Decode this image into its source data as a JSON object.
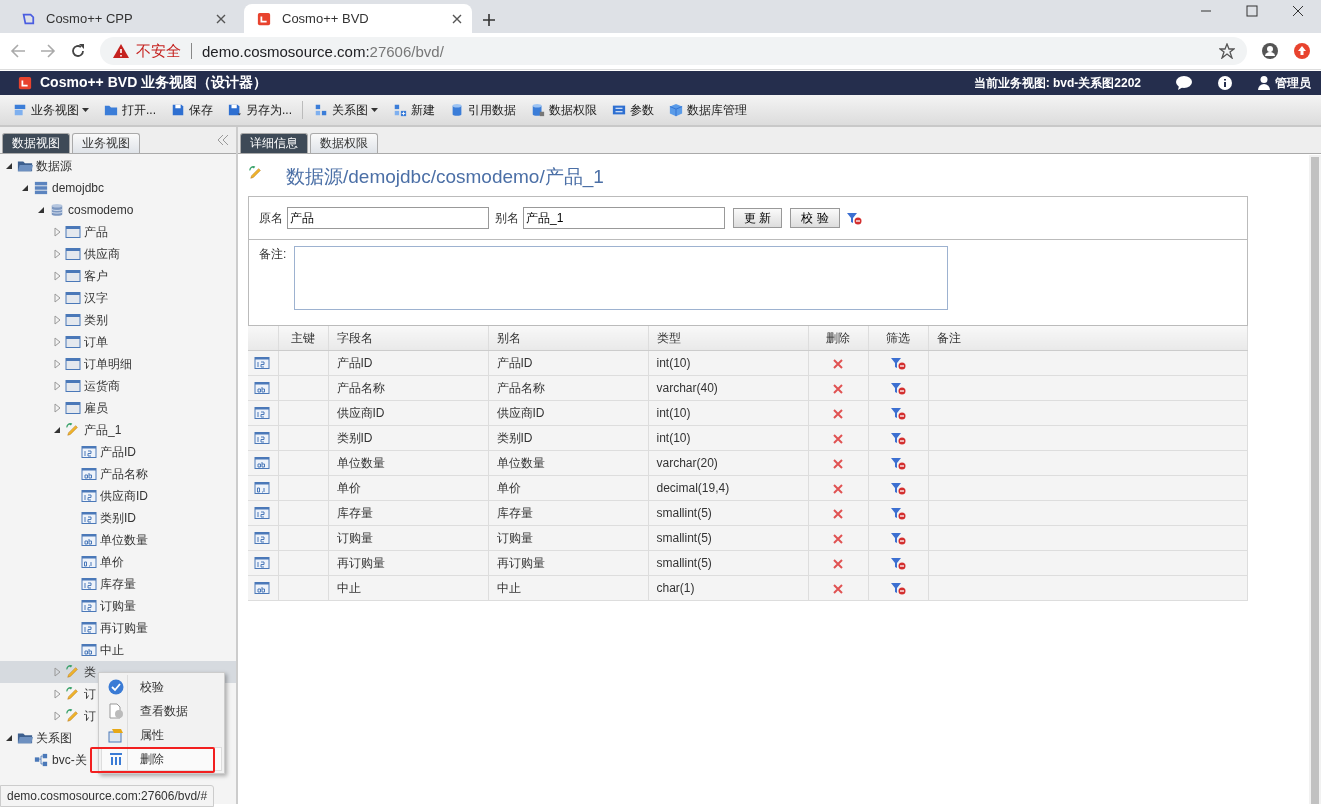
{
  "browser": {
    "tabs": [
      {
        "title": "Cosmo++ CPP",
        "selected": false
      },
      {
        "title": "Cosmo++ BVD",
        "selected": true
      }
    ],
    "security": "不安全",
    "url_host": "demo.cosmosource.com:",
    "url_path": "27606/bvd/"
  },
  "header": {
    "title": "Cosmo++ BVD 业务视图（设计器）",
    "current_view": "当前业务视图: bvd-关系图2202",
    "user": "管理员"
  },
  "toolbar": {
    "groups": [
      [
        {
          "label": "业务视图",
          "dropdown": true
        },
        {
          "label": "打开...",
          "dropdown": false
        },
        {
          "label": "保存",
          "dropdown": false
        },
        {
          "label": "另存为...",
          "dropdown": false
        }
      ],
      [
        {
          "label": "关系图",
          "dropdown": true
        },
        {
          "label": "新建",
          "dropdown": false
        },
        {
          "label": "引用数据",
          "dropdown": false
        },
        {
          "label": "数据权限",
          "dropdown": false
        },
        {
          "label": "参数",
          "dropdown": false
        },
        {
          "label": "数据库管理",
          "dropdown": false
        }
      ]
    ]
  },
  "sidebar": {
    "tabs": [
      {
        "label": "数据视图",
        "selected": true
      },
      {
        "label": "业务视图",
        "selected": false
      }
    ],
    "tree": [
      {
        "label": "数据源",
        "kind": "folder",
        "expanded": true,
        "selected": false,
        "children": [
          {
            "label": "demojdbc",
            "kind": "server",
            "expanded": true,
            "selected": false,
            "children": [
              {
                "label": "cosmodemo",
                "kind": "database",
                "expanded": true,
                "selected": false,
                "children": [
                  {
                    "label": "产品",
                    "kind": "table",
                    "expanded": false,
                    "selected": false
                  },
                  {
                    "label": "供应商",
                    "kind": "table",
                    "expanded": false,
                    "selected": false
                  },
                  {
                    "label": "客户",
                    "kind": "table",
                    "expanded": false,
                    "selected": false
                  },
                  {
                    "label": "汉字",
                    "kind": "table",
                    "expanded": false,
                    "selected": false
                  },
                  {
                    "label": "类别",
                    "kind": "table",
                    "expanded": false,
                    "selected": false
                  },
                  {
                    "label": "订单",
                    "kind": "table",
                    "expanded": false,
                    "selected": false
                  },
                  {
                    "label": "订单明细",
                    "kind": "table",
                    "expanded": false,
                    "selected": false
                  },
                  {
                    "label": "运货商",
                    "kind": "table",
                    "expanded": false,
                    "selected": false
                  },
                  {
                    "label": "雇员",
                    "kind": "table",
                    "expanded": false,
                    "selected": false
                  },
                  {
                    "label": "产品_1",
                    "kind": "view",
                    "expanded": true,
                    "selected": false,
                    "children": [
                      {
                        "label": "产品ID",
                        "kind": "int",
                        "selected": false
                      },
                      {
                        "label": "产品名称",
                        "kind": "text",
                        "selected": false
                      },
                      {
                        "label": "供应商ID",
                        "kind": "int",
                        "selected": false
                      },
                      {
                        "label": "类别ID",
                        "kind": "int",
                        "selected": false
                      },
                      {
                        "label": "单位数量",
                        "kind": "text",
                        "selected": false
                      },
                      {
                        "label": "单价",
                        "kind": "decimal",
                        "selected": false
                      },
                      {
                        "label": "库存量",
                        "kind": "int",
                        "selected": false
                      },
                      {
                        "label": "订购量",
                        "kind": "int",
                        "selected": false
                      },
                      {
                        "label": "再订购量",
                        "kind": "int",
                        "selected": false
                      },
                      {
                        "label": "中止",
                        "kind": "text",
                        "selected": false
                      }
                    ]
                  },
                  {
                    "label": "类",
                    "kind": "view",
                    "expanded": false,
                    "selected": true
                  },
                  {
                    "label": "订",
                    "kind": "view",
                    "expanded": false,
                    "selected": false
                  },
                  {
                    "label": "订",
                    "kind": "view",
                    "expanded": false,
                    "selected": false
                  }
                ]
              }
            ]
          }
        ]
      },
      {
        "label": "关系图",
        "kind": "folder",
        "expanded": true,
        "selected": false,
        "children": [
          {
            "label": "bvc-关",
            "kind": "diagram",
            "selected": false
          }
        ]
      }
    ]
  },
  "detail": {
    "tabs": [
      {
        "label": "详细信息",
        "selected": true
      },
      {
        "label": "数据权限",
        "selected": false
      }
    ],
    "path": "数据源/demojdbc/cosmodemo/产品_1",
    "original_name_label": "原名",
    "original_name": "产品",
    "alias_label": "别名",
    "alias": "产品_1",
    "update_button": "更 新",
    "validate_button": "校 验",
    "notes_label": "备注:",
    "table": {
      "columns": [
        "主键",
        "字段名",
        "别名",
        "类型",
        "删除",
        "筛选",
        "备注"
      ],
      "rows": [
        {
          "kind": "int",
          "name": "产品ID",
          "alias": "产品ID",
          "type": "int(10)"
        },
        {
          "kind": "text",
          "name": "产品名称",
          "alias": "产品名称",
          "type": "varchar(40)"
        },
        {
          "kind": "int",
          "name": "供应商ID",
          "alias": "供应商ID",
          "type": "int(10)"
        },
        {
          "kind": "int",
          "name": "类别ID",
          "alias": "类别ID",
          "type": "int(10)"
        },
        {
          "kind": "text",
          "name": "单位数量",
          "alias": "单位数量",
          "type": "varchar(20)"
        },
        {
          "kind": "decimal",
          "name": "单价",
          "alias": "单价",
          "type": "decimal(19,4)"
        },
        {
          "kind": "int",
          "name": "库存量",
          "alias": "库存量",
          "type": "smallint(5)"
        },
        {
          "kind": "int",
          "name": "订购量",
          "alias": "订购量",
          "type": "smallint(5)"
        },
        {
          "kind": "int",
          "name": "再订购量",
          "alias": "再订购量",
          "type": "smallint(5)"
        },
        {
          "kind": "text",
          "name": "中止",
          "alias": "中止",
          "type": "char(1)"
        }
      ]
    }
  },
  "context_menu": {
    "items": [
      {
        "label": "校验",
        "highlighted": false
      },
      {
        "label": "查看数据",
        "highlighted": false
      },
      {
        "label": "属性",
        "highlighted": false
      },
      {
        "label": "删除",
        "highlighted": true
      }
    ]
  },
  "status_url": "demo.cosmosource.com:27606/bvd/#"
}
